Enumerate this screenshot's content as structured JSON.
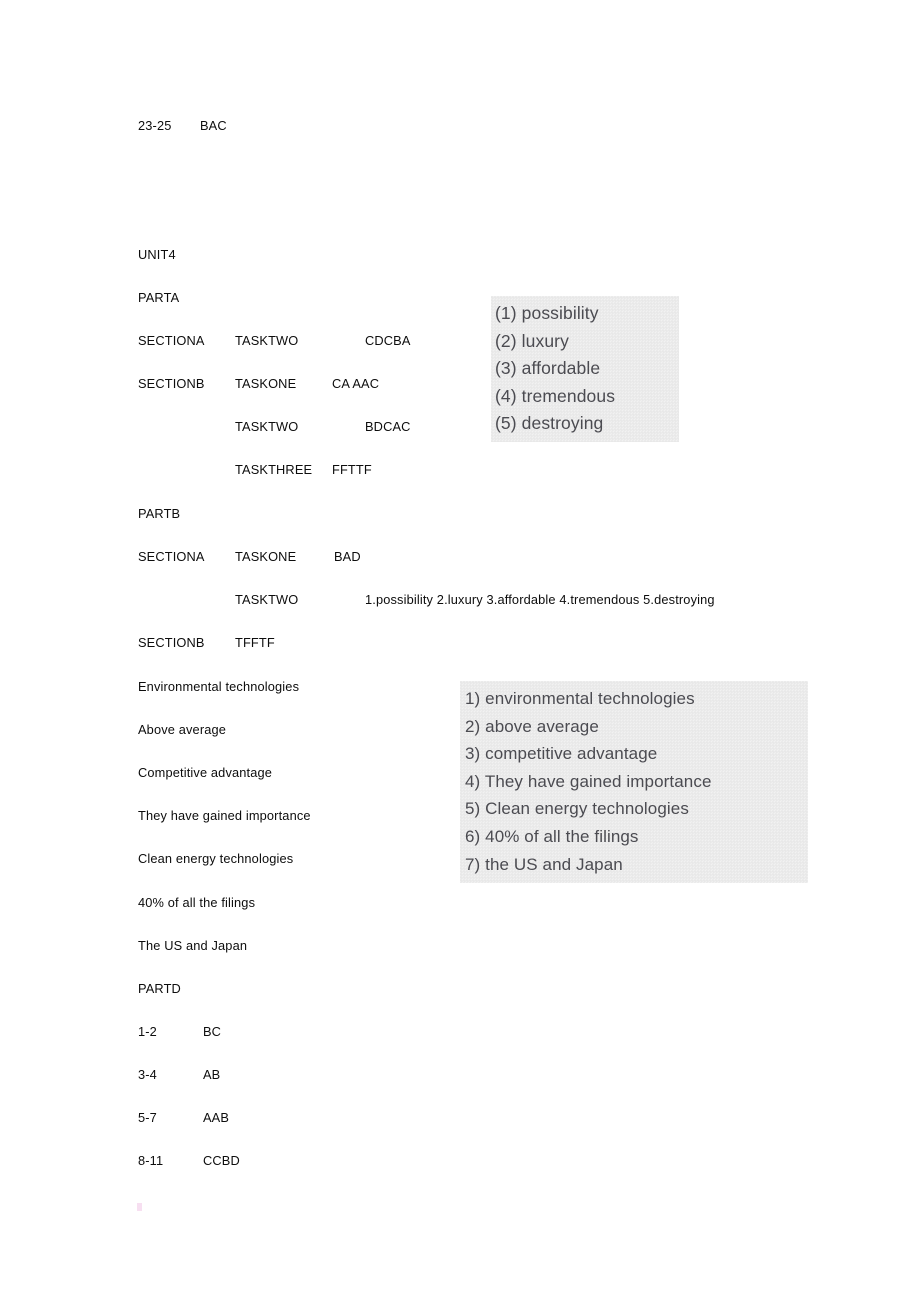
{
  "document": {
    "background_color": "#ffffff",
    "text_color": "#0d0d0d",
    "embedded_image_bg": "#ebebeb",
    "embedded_image_text_color": "#4b4b51"
  },
  "lines": {
    "l01_label": "23-25",
    "l01_answer": "BAC",
    "l02_unit": "UNIT4",
    "l03_part": "PARTA",
    "l04_section": "SECTIONA",
    "l04_task": "TASKTWO",
    "l04_answer": "CDCBA",
    "l05_section": "SECTIONB",
    "l05_task": "TASKONE",
    "l05_answer": "CA AAC",
    "l06_task": "TASKTWO",
    "l06_answer": "BDCAC",
    "l07_task": "TASKTHREE",
    "l07_answer": "FFTTF",
    "l08_part": "PARTB",
    "l09_section": "SECTIONA",
    "l09_task": "TASKONE",
    "l09_answer": "BAD",
    "l10_task": "TASKTWO",
    "l10_answer": "1.possibility 2.luxury 3.affordable 4.tremendous 5.destroying",
    "l11_section": "SECTIONB",
    "l11_answer": "TFFTF",
    "l12": "Environmental technologies",
    "l13": "Above average",
    "l14": "Competitive advantage",
    "l15": "They have gained importance",
    "l16": "Clean energy technologies",
    "l17": "40% of all the filings",
    "l18": "The US and Japan",
    "l19_part": "PARTD",
    "l20_label": "1-2",
    "l20_answer": "BC",
    "l21_label": "3-4",
    "l21_answer": "AB",
    "l22_label": "5-7",
    "l22_answer": "AAB",
    "l23_label": "8-11",
    "l23_answer": "CCBD"
  },
  "embedded_image_one": {
    "items": [
      "(1) possibility",
      "(2) luxury",
      "(3) affordable",
      "(4) tremendous",
      "(5) destroying"
    ]
  },
  "embedded_image_two": {
    "items": [
      "1) environmental technologies",
      "2) above average",
      "3) competitive advantage",
      "4) They have gained importance",
      "5) Clean energy technologies",
      "6) 40% of all the filings",
      "7) the US and Japan"
    ]
  }
}
